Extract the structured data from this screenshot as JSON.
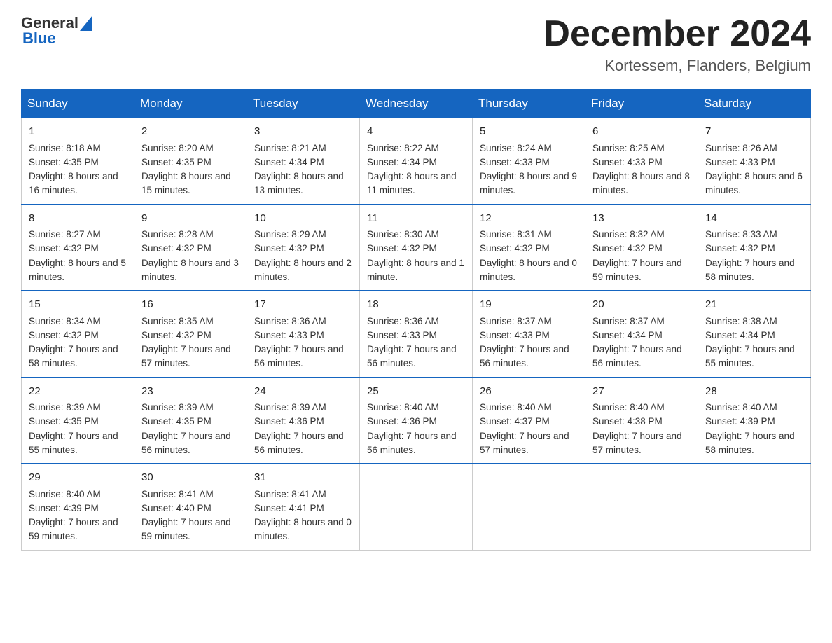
{
  "header": {
    "logo_general": "General",
    "logo_blue": "Blue",
    "month_title": "December 2024",
    "location": "Kortessem, Flanders, Belgium"
  },
  "days_of_week": [
    "Sunday",
    "Monday",
    "Tuesday",
    "Wednesday",
    "Thursday",
    "Friday",
    "Saturday"
  ],
  "weeks": [
    [
      {
        "day": "1",
        "sunrise": "8:18 AM",
        "sunset": "4:35 PM",
        "daylight": "8 hours and 16 minutes."
      },
      {
        "day": "2",
        "sunrise": "8:20 AM",
        "sunset": "4:35 PM",
        "daylight": "8 hours and 15 minutes."
      },
      {
        "day": "3",
        "sunrise": "8:21 AM",
        "sunset": "4:34 PM",
        "daylight": "8 hours and 13 minutes."
      },
      {
        "day": "4",
        "sunrise": "8:22 AM",
        "sunset": "4:34 PM",
        "daylight": "8 hours and 11 minutes."
      },
      {
        "day": "5",
        "sunrise": "8:24 AM",
        "sunset": "4:33 PM",
        "daylight": "8 hours and 9 minutes."
      },
      {
        "day": "6",
        "sunrise": "8:25 AM",
        "sunset": "4:33 PM",
        "daylight": "8 hours and 8 minutes."
      },
      {
        "day": "7",
        "sunrise": "8:26 AM",
        "sunset": "4:33 PM",
        "daylight": "8 hours and 6 minutes."
      }
    ],
    [
      {
        "day": "8",
        "sunrise": "8:27 AM",
        "sunset": "4:32 PM",
        "daylight": "8 hours and 5 minutes."
      },
      {
        "day": "9",
        "sunrise": "8:28 AM",
        "sunset": "4:32 PM",
        "daylight": "8 hours and 3 minutes."
      },
      {
        "day": "10",
        "sunrise": "8:29 AM",
        "sunset": "4:32 PM",
        "daylight": "8 hours and 2 minutes."
      },
      {
        "day": "11",
        "sunrise": "8:30 AM",
        "sunset": "4:32 PM",
        "daylight": "8 hours and 1 minute."
      },
      {
        "day": "12",
        "sunrise": "8:31 AM",
        "sunset": "4:32 PM",
        "daylight": "8 hours and 0 minutes."
      },
      {
        "day": "13",
        "sunrise": "8:32 AM",
        "sunset": "4:32 PM",
        "daylight": "7 hours and 59 minutes."
      },
      {
        "day": "14",
        "sunrise": "8:33 AM",
        "sunset": "4:32 PM",
        "daylight": "7 hours and 58 minutes."
      }
    ],
    [
      {
        "day": "15",
        "sunrise": "8:34 AM",
        "sunset": "4:32 PM",
        "daylight": "7 hours and 58 minutes."
      },
      {
        "day": "16",
        "sunrise": "8:35 AM",
        "sunset": "4:32 PM",
        "daylight": "7 hours and 57 minutes."
      },
      {
        "day": "17",
        "sunrise": "8:36 AM",
        "sunset": "4:33 PM",
        "daylight": "7 hours and 56 minutes."
      },
      {
        "day": "18",
        "sunrise": "8:36 AM",
        "sunset": "4:33 PM",
        "daylight": "7 hours and 56 minutes."
      },
      {
        "day": "19",
        "sunrise": "8:37 AM",
        "sunset": "4:33 PM",
        "daylight": "7 hours and 56 minutes."
      },
      {
        "day": "20",
        "sunrise": "8:37 AM",
        "sunset": "4:34 PM",
        "daylight": "7 hours and 56 minutes."
      },
      {
        "day": "21",
        "sunrise": "8:38 AM",
        "sunset": "4:34 PM",
        "daylight": "7 hours and 55 minutes."
      }
    ],
    [
      {
        "day": "22",
        "sunrise": "8:39 AM",
        "sunset": "4:35 PM",
        "daylight": "7 hours and 55 minutes."
      },
      {
        "day": "23",
        "sunrise": "8:39 AM",
        "sunset": "4:35 PM",
        "daylight": "7 hours and 56 minutes."
      },
      {
        "day": "24",
        "sunrise": "8:39 AM",
        "sunset": "4:36 PM",
        "daylight": "7 hours and 56 minutes."
      },
      {
        "day": "25",
        "sunrise": "8:40 AM",
        "sunset": "4:36 PM",
        "daylight": "7 hours and 56 minutes."
      },
      {
        "day": "26",
        "sunrise": "8:40 AM",
        "sunset": "4:37 PM",
        "daylight": "7 hours and 57 minutes."
      },
      {
        "day": "27",
        "sunrise": "8:40 AM",
        "sunset": "4:38 PM",
        "daylight": "7 hours and 57 minutes."
      },
      {
        "day": "28",
        "sunrise": "8:40 AM",
        "sunset": "4:39 PM",
        "daylight": "7 hours and 58 minutes."
      }
    ],
    [
      {
        "day": "29",
        "sunrise": "8:40 AM",
        "sunset": "4:39 PM",
        "daylight": "7 hours and 59 minutes."
      },
      {
        "day": "30",
        "sunrise": "8:41 AM",
        "sunset": "4:40 PM",
        "daylight": "7 hours and 59 minutes."
      },
      {
        "day": "31",
        "sunrise": "8:41 AM",
        "sunset": "4:41 PM",
        "daylight": "8 hours and 0 minutes."
      },
      null,
      null,
      null,
      null
    ]
  ],
  "labels": {
    "sunrise": "Sunrise:",
    "sunset": "Sunset:",
    "daylight": "Daylight:"
  }
}
